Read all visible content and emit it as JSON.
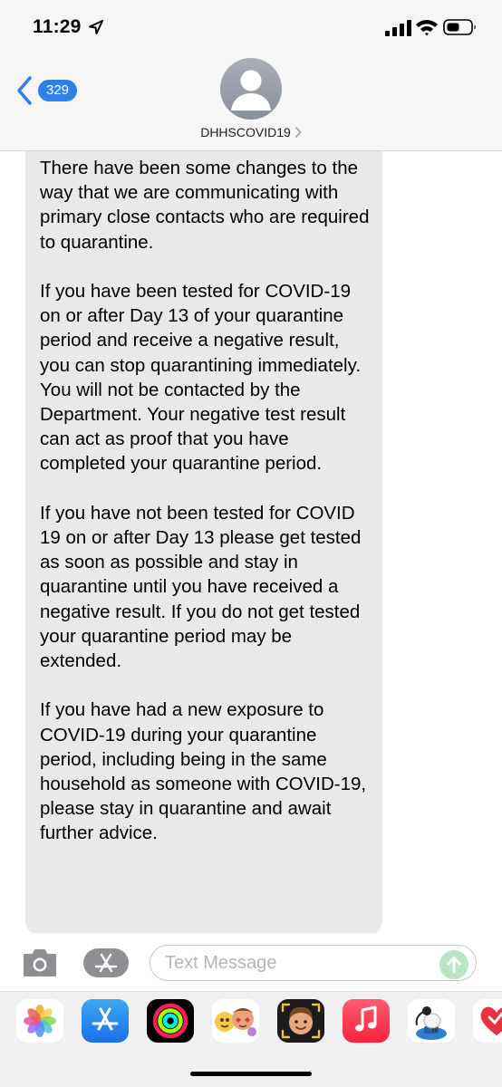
{
  "status_bar": {
    "time": "11:29",
    "location_icon": "location-arrow-icon",
    "signal_icon": "cellular-signal-icon",
    "wifi_icon": "wifi-icon",
    "battery_icon": "battery-icon"
  },
  "header": {
    "back_count": "329",
    "contact_name": "DHHSCOVID19",
    "avatar_icon": "person-silhouette-icon",
    "accent_color": "#2f80ed"
  },
  "message": {
    "bubble_color": "#e9e9eb",
    "paragraphs": [
      "There have been some changes to the way that we are communicating with primary close contacts who are required to quarantine.",
      "If you have been tested for COVID-19 on or after Day 13 of your quarantine period and receive a negative result, you can stop quarantining immediately. You will not be contacted by the Department. Your negative test result can act as proof that you have completed your quarantine period.",
      "If you have not been tested for COVID 19 on or after Day 13 please get tested as soon as possible and stay in quarantine until you have received a negative result. If you do not get tested your quarantine period may be extended.",
      "If you have had a new exposure to COVID-19 during your quarantine period, including being in the same household as someone with COVID-19, please stay in quarantine and await further advice."
    ]
  },
  "input_bar": {
    "placeholder": "Text Message",
    "camera_icon": "camera-icon",
    "apps_icon": "app-store-icon",
    "send_icon": "send-arrow-icon"
  },
  "app_drawer": {
    "apps": [
      "photos-icon",
      "app-store-icon",
      "activity-icon",
      "memoji-stickers-icon",
      "memoji-icon",
      "music-icon",
      "bird-sticker-icon",
      "heart-sticker-icon"
    ]
  }
}
